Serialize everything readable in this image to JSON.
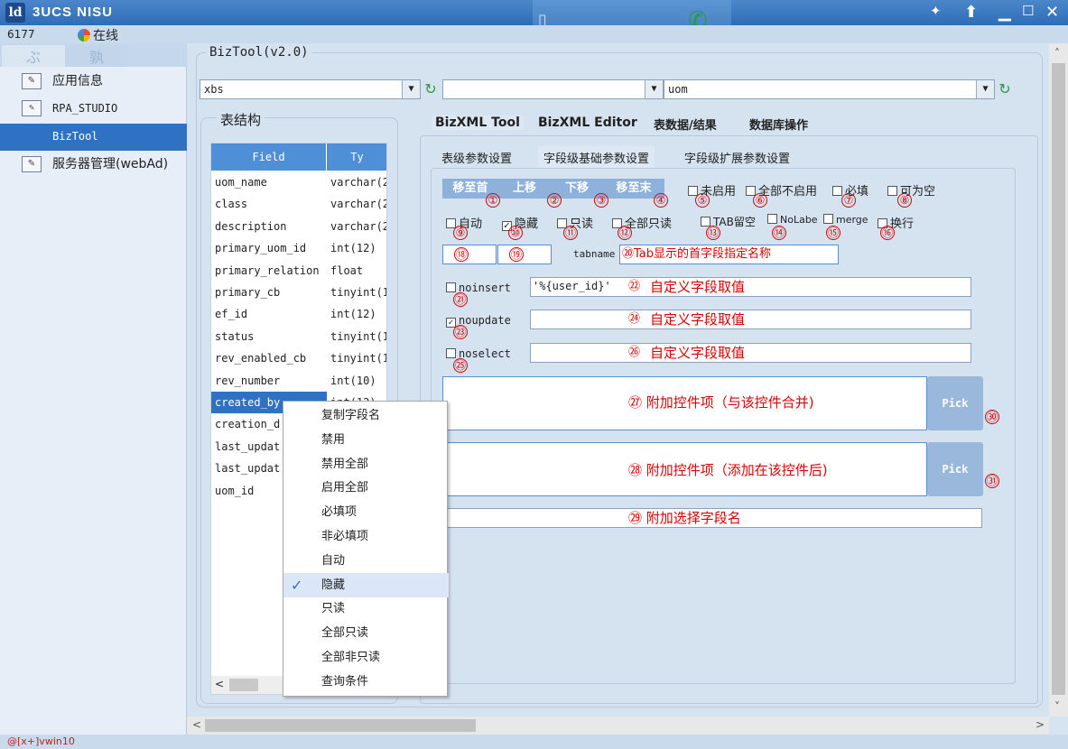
{
  "app": {
    "logo": "ld",
    "title": "3UCS NISU"
  },
  "status": {
    "user_id": "6177",
    "online_label": "在线"
  },
  "sidebar": {
    "items": [
      {
        "label": "应用信息",
        "icon": "edit-doc-icon"
      },
      {
        "label": "RPA_STUDIO",
        "icon": "edit-doc-icon"
      },
      {
        "label": "BizTool",
        "icon": ""
      },
      {
        "label": "服务器管理(webAd)",
        "icon": "edit-doc-icon"
      }
    ]
  },
  "main": {
    "group_title": "BizTool(v2.0)",
    "combo1": "xbs",
    "combo2": "",
    "combo3": "uom",
    "table_group_label": "表结构",
    "table": {
      "columns": [
        "Field",
        "Ty"
      ],
      "rows": [
        [
          "uom_name",
          "varchar(2"
        ],
        [
          "class",
          "varchar(2"
        ],
        [
          "description",
          "varchar(2"
        ],
        [
          "primary_uom_id",
          "int(12)"
        ],
        [
          "primary_relation",
          "float"
        ],
        [
          "primary_cb",
          "tinyint(1"
        ],
        [
          "ef_id",
          "int(12)"
        ],
        [
          "status",
          "tinyint(1"
        ],
        [
          "rev_enabled_cb",
          "tinyint(1"
        ],
        [
          "rev_number",
          "int(10)"
        ],
        [
          "created_by",
          "int(12)"
        ],
        [
          "creation_d",
          ""
        ],
        [
          "last_updat",
          ""
        ],
        [
          "last_updat",
          ""
        ],
        [
          "uom_id",
          ""
        ]
      ]
    },
    "tabs": [
      "BizXML Tool",
      "BizXML Editor",
      "表数据/结果",
      "数据库操作"
    ],
    "subtabs": [
      "表级参数设置",
      "字段级基础参数设置",
      "字段级扩展参数设置"
    ],
    "buttons": [
      "移至首",
      "上移",
      "下移",
      "移至末"
    ],
    "checks_row1": [
      "未启用",
      "全部不启用",
      "必填",
      "可为空"
    ],
    "checks_row2": [
      "自动",
      "隐藏",
      "只读",
      "全部只读",
      "TAB留空",
      "NoLabe",
      "merge",
      "换行"
    ],
    "nums": [
      "①",
      "②",
      "③",
      "④",
      "⑤",
      "⑥",
      "⑦",
      "⑧",
      "⑨",
      "⑩",
      "⑪",
      "⑫",
      "⑬",
      "⑭",
      "⑮",
      "⑯",
      "⑱",
      "⑲",
      "⑳",
      "㉑",
      "㉒",
      "㉓",
      "㉔",
      "㉕",
      "㉖",
      "㉗",
      "㉘",
      "㉙",
      "㉚",
      "㉛"
    ],
    "tabname_label": "tabname",
    "tabname_value": "Tab显示的首字段指定名称",
    "noinsert_label": "noinsert",
    "noinsert_value": "'%{user_id}'",
    "noinsert_hint": "自定义字段取值",
    "noupdate_label": "noupdate",
    "noupdate_hint": "自定义字段取值",
    "noselect_label": "noselect",
    "noselect_hint": "自定义字段取值",
    "extra1": "附加控件项（与该控件合并)",
    "extra2": "附加控件项（添加在该控件后)",
    "extra3": "附加选择字段名",
    "pick": "Pick"
  },
  "context_menu": [
    "复制字段名",
    "禁用",
    "禁用全部",
    "启用全部",
    "必填项",
    "非必填项",
    "自动",
    "隐藏",
    "只读",
    "全部只读",
    "全部非只读",
    "查询条件"
  ],
  "bottom_status": "@[x+]vwin10"
}
